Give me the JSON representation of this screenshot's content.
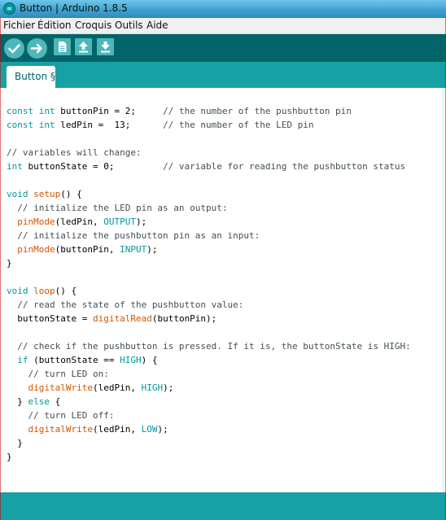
{
  "window": {
    "title": "Button | Arduino 1.8.5",
    "icon": "arduino-logo-icon"
  },
  "menu": [
    "Fichier",
    "Édition",
    "Croquis",
    "Outils",
    "Aide"
  ],
  "toolbar": {
    "buttons": [
      "verify-icon",
      "upload-icon",
      "new-icon",
      "open-icon",
      "save-icon"
    ]
  },
  "tab": {
    "label": "Button §"
  },
  "colors": {
    "toolbar": "#006468",
    "tabbar": "#17a1a5",
    "keyword": "#00979c",
    "function": "#d35400",
    "comment": "#434f54"
  },
  "code": [
    [
      [
        "kw",
        "const"
      ],
      [
        "pl",
        " "
      ],
      [
        "kw",
        "int"
      ],
      [
        "pl",
        " buttonPin = 2;     "
      ],
      [
        "cm",
        "// the number of the pushbutton pin"
      ]
    ],
    [
      [
        "kw",
        "const"
      ],
      [
        "pl",
        " "
      ],
      [
        "kw",
        "int"
      ],
      [
        "pl",
        " ledPin =  13;      "
      ],
      [
        "cm",
        "// the number of the LED pin"
      ]
    ],
    [],
    [
      [
        "cm",
        "// variables will change:"
      ]
    ],
    [
      [
        "kw",
        "int"
      ],
      [
        "pl",
        " buttonState = 0;         "
      ],
      [
        "cm",
        "// variable for reading the pushbutton status"
      ]
    ],
    [],
    [
      [
        "kw",
        "void"
      ],
      [
        "pl",
        " "
      ],
      [
        "fn",
        "setup"
      ],
      [
        "pl",
        "() {"
      ]
    ],
    [
      [
        "pl",
        "  "
      ],
      [
        "cm",
        "// initialize the LED pin as an output:"
      ]
    ],
    [
      [
        "pl",
        "  "
      ],
      [
        "fn",
        "pinMode"
      ],
      [
        "pl",
        "(ledPin, "
      ],
      [
        "const",
        "OUTPUT"
      ],
      [
        "pl",
        ");"
      ]
    ],
    [
      [
        "pl",
        "  "
      ],
      [
        "cm",
        "// initialize the pushbutton pin as an input:"
      ]
    ],
    [
      [
        "pl",
        "  "
      ],
      [
        "fn",
        "pinMode"
      ],
      [
        "pl",
        "(buttonPin, "
      ],
      [
        "const",
        "INPUT"
      ],
      [
        "pl",
        ");"
      ]
    ],
    [
      [
        "pl",
        "}"
      ]
    ],
    [],
    [
      [
        "kw",
        "void"
      ],
      [
        "pl",
        " "
      ],
      [
        "fn",
        "loop"
      ],
      [
        "pl",
        "() {"
      ]
    ],
    [
      [
        "pl",
        "  "
      ],
      [
        "cm",
        "// read the state of the pushbutton value:"
      ]
    ],
    [
      [
        "pl",
        "  buttonState = "
      ],
      [
        "fn",
        "digitalRead"
      ],
      [
        "pl",
        "(buttonPin);"
      ]
    ],
    [],
    [
      [
        "pl",
        "  "
      ],
      [
        "cm",
        "// check if the pushbutton is pressed. If it is, the buttonState is HIGH:"
      ]
    ],
    [
      [
        "pl",
        "  "
      ],
      [
        "kw",
        "if"
      ],
      [
        "pl",
        " (buttonState == "
      ],
      [
        "const",
        "HIGH"
      ],
      [
        "pl",
        ") {"
      ]
    ],
    [
      [
        "pl",
        "    "
      ],
      [
        "cm",
        "// turn LED on:"
      ]
    ],
    [
      [
        "pl",
        "    "
      ],
      [
        "fn",
        "digitalWrite"
      ],
      [
        "pl",
        "(ledPin, "
      ],
      [
        "const",
        "HIGH"
      ],
      [
        "pl",
        ");"
      ]
    ],
    [
      [
        "pl",
        "  } "
      ],
      [
        "kw",
        "else"
      ],
      [
        "pl",
        " {"
      ]
    ],
    [
      [
        "pl",
        "    "
      ],
      [
        "cm",
        "// turn LED off:"
      ]
    ],
    [
      [
        "pl",
        "    "
      ],
      [
        "fn",
        "digitalWrite"
      ],
      [
        "pl",
        "(ledPin, "
      ],
      [
        "const",
        "LOW"
      ],
      [
        "pl",
        ");"
      ]
    ],
    [
      [
        "pl",
        "  }"
      ]
    ],
    [
      [
        "pl",
        "}"
      ]
    ]
  ]
}
